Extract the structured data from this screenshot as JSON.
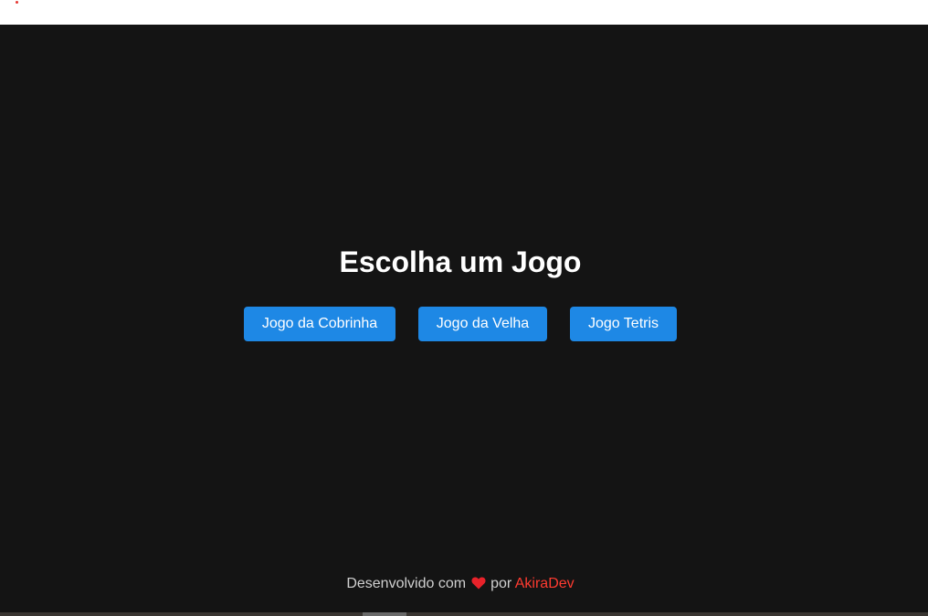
{
  "main": {
    "title": "Escolha um Jogo",
    "games": [
      {
        "label": "Jogo da Cobrinha"
      },
      {
        "label": "Jogo da Velha"
      },
      {
        "label": "Jogo Tetris"
      }
    ]
  },
  "footer": {
    "prefix": "Desenvolvido com",
    "heart_icon": "heart-icon",
    "middle": "por",
    "author": "AkiraDev"
  },
  "colors": {
    "background": "#141414",
    "button": "#1e88e5",
    "accent": "#ff3b30",
    "heart": "#e8222a",
    "text": "#ffffff"
  }
}
